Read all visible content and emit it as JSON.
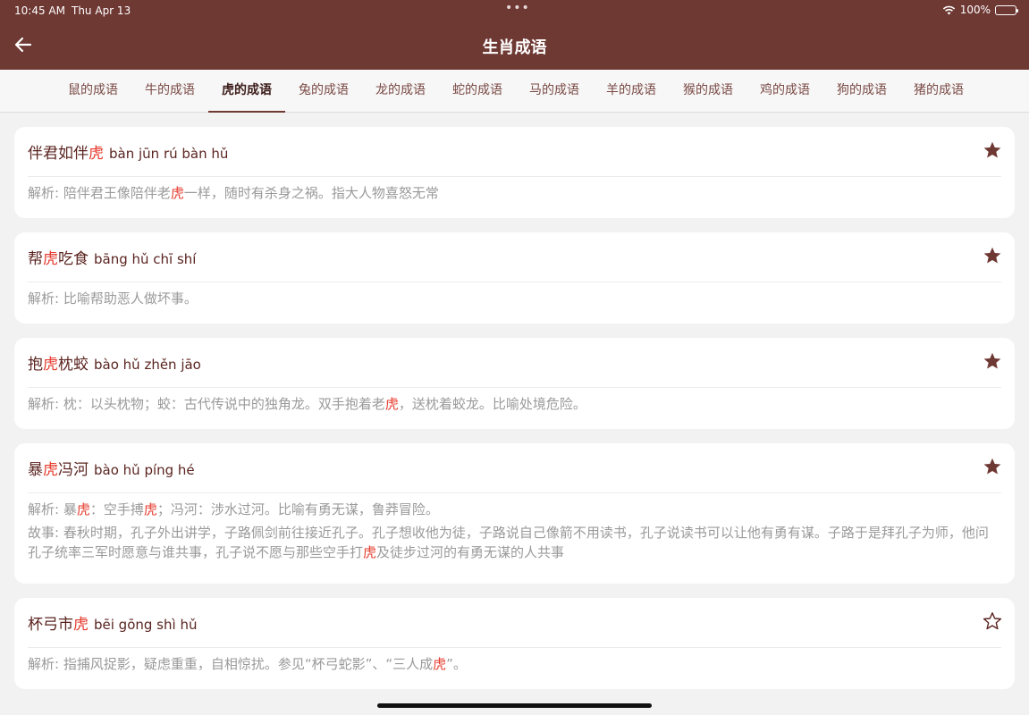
{
  "status_bar": {
    "time": "10:45 AM",
    "date": "Thu Apr 13",
    "battery": "100%",
    "battery_level": 1.0
  },
  "header": {
    "title": "生肖成语"
  },
  "tabs": [
    {
      "label": "鼠的成语"
    },
    {
      "label": "牛的成语"
    },
    {
      "label": "虎的成语",
      "active": true
    },
    {
      "label": "兔的成语"
    },
    {
      "label": "龙的成语"
    },
    {
      "label": "蛇的成语"
    },
    {
      "label": "马的成语"
    },
    {
      "label": "羊的成语"
    },
    {
      "label": "猴的成语"
    },
    {
      "label": "鸡的成语"
    },
    {
      "label": "狗的成语"
    },
    {
      "label": "猪的成语"
    }
  ],
  "colors": {
    "header": "#6e3833",
    "highlight": "#e63b2e",
    "idiom_text": "#5a2420",
    "desc_text": "#9a9a9a"
  },
  "cards": [
    {
      "idiom": [
        "伴君如伴",
        "虎",
        ""
      ],
      "pinyin": "bàn jūn rú bàn hǔ",
      "favorited": true,
      "lines": [
        {
          "prefix": "解析: ",
          "parts": [
            "陪伴君王像陪伴老",
            "虎",
            "一样，随时有杀身之祸。指大人物喜怒无常"
          ]
        }
      ]
    },
    {
      "idiom": [
        "帮",
        "虎",
        "吃食"
      ],
      "pinyin": "bāng hǔ chī shí",
      "favorited": true,
      "lines": [
        {
          "prefix": "解析: ",
          "parts": [
            "比喻帮助恶人做坏事。",
            "",
            ""
          ]
        }
      ]
    },
    {
      "idiom": [
        "抱",
        "虎",
        "枕蛟"
      ],
      "pinyin": "bào hǔ zhěn jāo",
      "favorited": true,
      "lines": [
        {
          "prefix": "解析: ",
          "parts": [
            "枕：以头枕物；蛟：古代传说中的独角龙。双手抱着老",
            "虎",
            "，送枕着蛟龙。比喻处境危险。"
          ]
        }
      ]
    },
    {
      "idiom": [
        "暴",
        "虎",
        "冯河"
      ],
      "pinyin": "bào hǔ píng hé",
      "favorited": true,
      "lines": [
        {
          "prefix": "解析: ",
          "parts": [
            "暴",
            "虎",
            "：空手搏",
            "虎",
            "；冯河：涉水过河。比喻有勇无谋，鲁莽冒险。"
          ]
        },
        {
          "prefix": "故事: ",
          "parts": [
            "春秋时期，孔子外出讲学，子路佩剑前往接近孔子。孔子想收他为徒，子路说自己像箭不用读书，孔子说读书可以让他有勇有谋。子路于是拜孔子为师，他问孔子统率三军时愿意与谁共事，孔子说不愿与那些空手打",
            "虎",
            "及徒步过河的有勇无谋的人共事"
          ]
        }
      ]
    },
    {
      "idiom": [
        "杯弓市",
        "虎",
        ""
      ],
      "pinyin": "bēi gōng shì hǔ",
      "favorited": false,
      "lines": [
        {
          "prefix": "解析: ",
          "parts": [
            "指捕风捉影，疑虑重重，自相惊扰。参见“杯弓蛇影”、“三人成",
            "虎",
            "”。"
          ]
        }
      ]
    }
  ]
}
